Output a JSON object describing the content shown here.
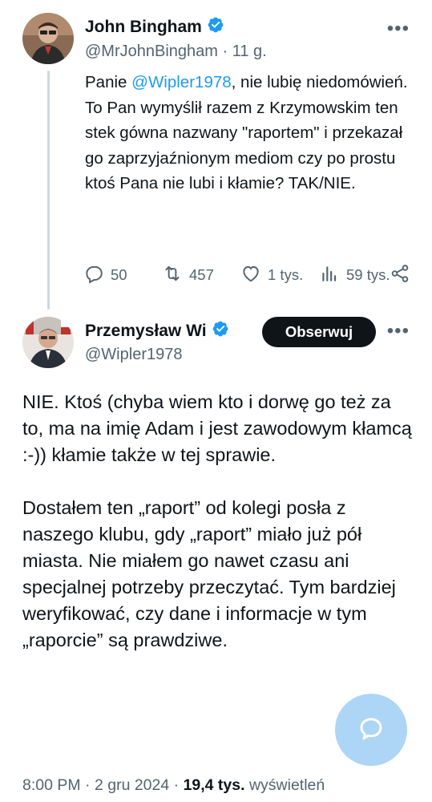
{
  "reply_parent": {
    "author_name": "John Bingham",
    "handle": "@MrJohnBingham",
    "separator": "·",
    "time_ago": "11 g.",
    "text_prefix": "Panie ",
    "mention": "@Wipler1978",
    "text_rest": ", nie lubię niedomówień. To Pan wymyślił razem z Krzymowskim ten stek gówna nazwany \"raportem\" i przekazał go zaprzyjaźnionym mediom czy po prostu ktoś Pana nie lubi i kłamie? TAK/NIE.",
    "actions": {
      "replies": "50",
      "retweets": "457",
      "likes": "1 tys.",
      "views": "59 tys."
    }
  },
  "main_tweet": {
    "author_name": "Przemysław Wipler",
    "author_name_visible": "Przemysław Wi",
    "handle": "@Wipler1978",
    "follow_label": "Obserwuj",
    "paragraphs": [
      "NIE. Ktoś (chyba wiem kto i dorwę go też za to, ma na imię Adam i jest zawodowym kłamcą :-)) kłamie także w tej sprawie.",
      "Dostałem ten „raport” od kolegi posła z naszego klubu, gdy „raport” miało już pół miasta. Nie miałem go nawet czasu ani specjalnej potrzeby przeczytać. Tym bardziej weryfikować, czy dane i informacje w tym „raporcie” są prawdziwe."
    ],
    "meta": {
      "time": "8:00 PM",
      "sep": "·",
      "date": "2 gru 2024",
      "sep2": "·",
      "views_count": "19,4 tys.",
      "views_label": "wyświetleń"
    }
  },
  "colors": {
    "accent": "#1d9bf0",
    "text": "#0f1419",
    "secondary": "#536471",
    "thread_line": "#cfd9de",
    "fab": "#a9d3f5"
  },
  "icons": {
    "verified": "verified-badge-icon",
    "more": "more-dots-icon",
    "reply": "reply-icon",
    "retweet": "retweet-icon",
    "like": "heart-icon",
    "views": "views-bars-icon",
    "share": "share-icon",
    "compose": "compose-chat-icon"
  }
}
